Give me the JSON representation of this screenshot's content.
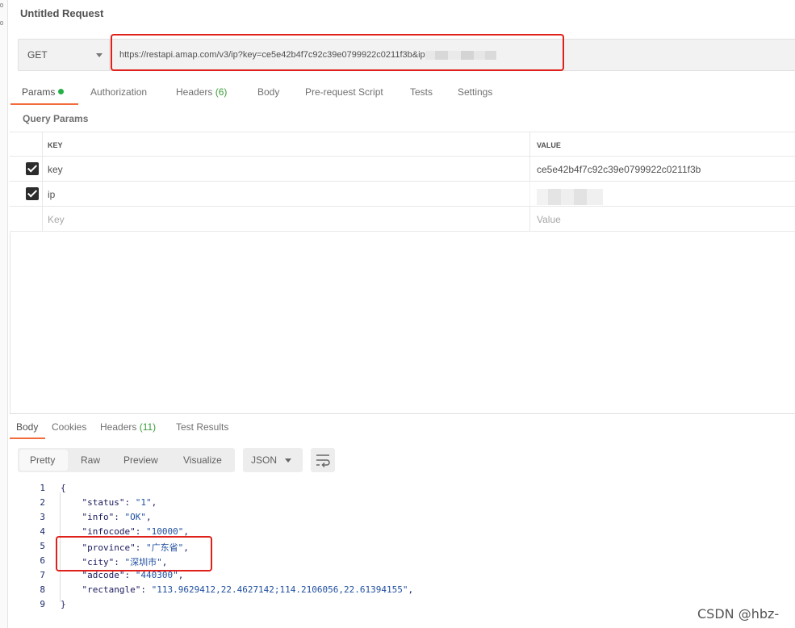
{
  "request": {
    "title": "Untitled Request",
    "method": "GET",
    "url": "https://restapi.amap.com/v3/ip?key=ce5e42b4f7c92c39e0799922c0211f3b&ip"
  },
  "request_tabs": [
    {
      "label": "Params",
      "count": ""
    },
    {
      "label": "Authorization",
      "count": ""
    },
    {
      "label": "Headers",
      "count": "(6)"
    },
    {
      "label": "Body",
      "count": ""
    },
    {
      "label": "Pre-request Script",
      "count": ""
    },
    {
      "label": "Tests",
      "count": ""
    },
    {
      "label": "Settings",
      "count": ""
    }
  ],
  "params": {
    "section_label": "Query Params",
    "key_header": "KEY",
    "value_header": "VALUE",
    "rows": [
      {
        "key": "key",
        "value": "ce5e42b4f7c92c39e0799922c0211f3b",
        "checked": true
      },
      {
        "key": "ip",
        "value": "",
        "checked": true
      }
    ],
    "key_placeholder": "Key",
    "value_placeholder": "Value"
  },
  "response_tabs": [
    {
      "label": "Body",
      "count": ""
    },
    {
      "label": "Cookies",
      "count": ""
    },
    {
      "label": "Headers",
      "count": "(11)"
    },
    {
      "label": "Test Results",
      "count": ""
    }
  ],
  "format_buttons": [
    "Pretty",
    "Raw",
    "Preview",
    "Visualize"
  ],
  "format_select": "JSON",
  "code_lines": [
    {
      "n": "1",
      "key": "",
      "value": "",
      "open": "{"
    },
    {
      "n": "2",
      "key": "\"status\"",
      "value": "\"1\""
    },
    {
      "n": "3",
      "key": "\"info\"",
      "value": "\"OK\""
    },
    {
      "n": "4",
      "key": "\"infocode\"",
      "value": "\"10000\""
    },
    {
      "n": "5",
      "key": "\"province\"",
      "value": "\"广东省\""
    },
    {
      "n": "6",
      "key": "\"city\"",
      "value": "\"深圳市\""
    },
    {
      "n": "7",
      "key": "\"adcode\"",
      "value": "\"440300\""
    },
    {
      "n": "8",
      "key": "\"rectangle\"",
      "value": "\"113.9629412,22.4627142;114.2106056,22.61394155\""
    },
    {
      "n": "9",
      "key": "",
      "value": "",
      "close": "}"
    }
  ],
  "watermark": "CSDN @hbz-",
  "colors": {
    "accent": "#f26b3a",
    "annotation_red": "#e0201a",
    "status_green": "#26b047"
  }
}
